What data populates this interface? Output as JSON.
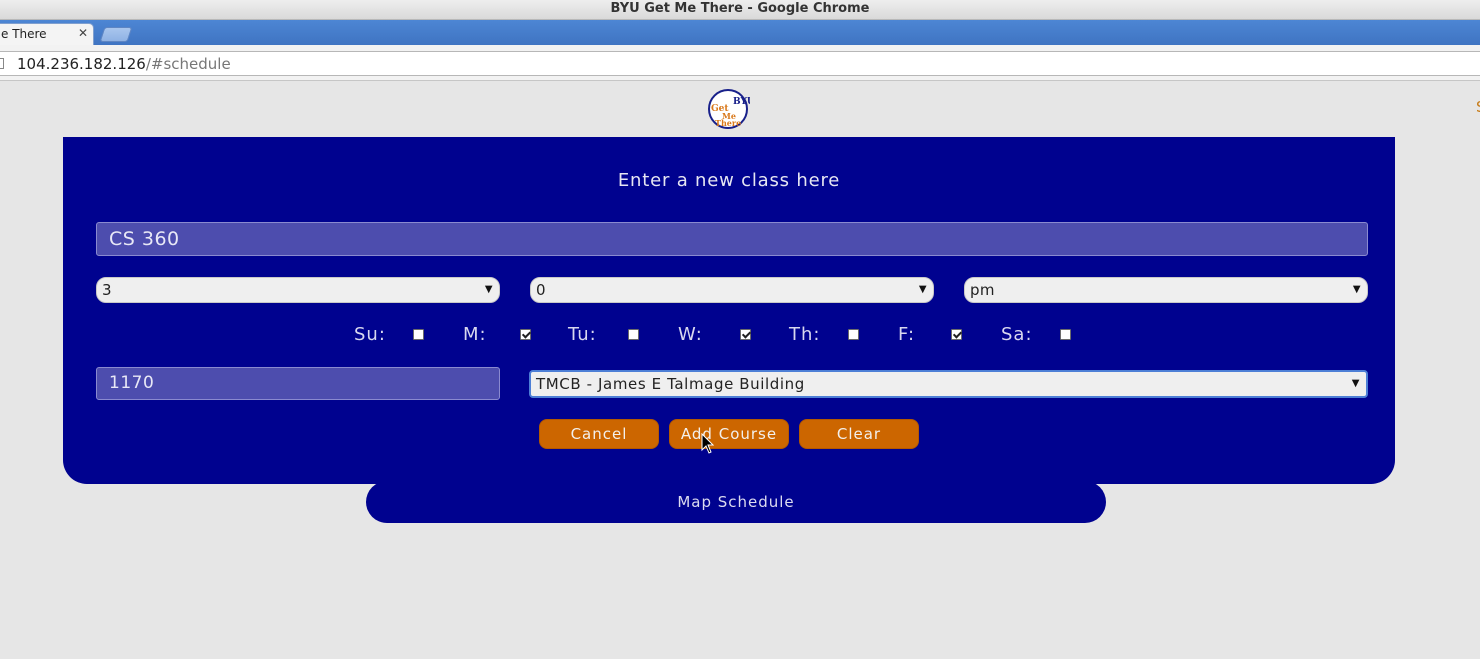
{
  "browser": {
    "window_title": "BYU Get Me There - Google Chrome",
    "tab_title": "e There",
    "tab_close": "✕",
    "url_host": "104.236.182.126",
    "url_path": "/#schedule"
  },
  "page": {
    "edge_glyph": "S",
    "form": {
      "title": "Enter a new class here",
      "course_value": "CS 360",
      "hour_value": "3",
      "minute_value": "0",
      "ampm_value": "pm",
      "days": [
        {
          "label": "Su:",
          "checked": false
        },
        {
          "label": "M:",
          "checked": true
        },
        {
          "label": "Tu:",
          "checked": false
        },
        {
          "label": "W:",
          "checked": true
        },
        {
          "label": "Th:",
          "checked": false
        },
        {
          "label": "F:",
          "checked": true
        },
        {
          "label": "Sa:",
          "checked": false
        }
      ],
      "room_value": "1170",
      "building_value": "TMCB - James E Talmage Building",
      "buttons": {
        "cancel": "Cancel",
        "add": "Add Course",
        "clear": "Clear"
      }
    },
    "map_schedule_label": "Map Schedule",
    "colors": {
      "panel": "#00028f",
      "button": "#cc6600",
      "input": "#4d4dae"
    },
    "logo": {
      "line1": "BYU",
      "line2": "Get",
      "line3": "Me",
      "line4": "There"
    }
  }
}
